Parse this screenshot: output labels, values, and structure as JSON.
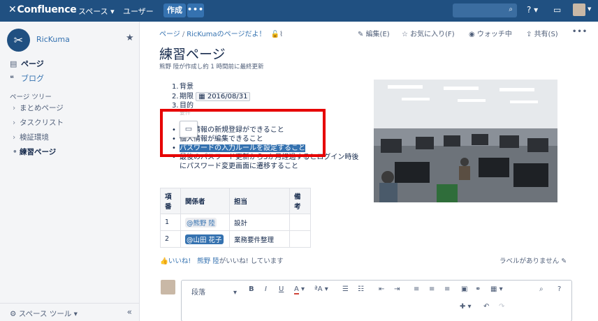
{
  "topbar": {
    "logo": "Confluence",
    "nav": [
      "スペース ▾",
      "ユーザー"
    ],
    "create": "作成",
    "more": "•••",
    "help": "? ▾",
    "inbox": "▭"
  },
  "sidebar": {
    "space_name": "RicKuma",
    "nav": [
      {
        "label": "ページ",
        "icon": "pages-icon"
      },
      {
        "label": "ブログ",
        "icon": "blog-icon"
      }
    ],
    "tree_heading": "ページ ツリー",
    "tree": [
      "まとめページ",
      "タスクリスト",
      "検証環境",
      "練習ページ"
    ],
    "footer_tools": "スペース ツール ▾",
    "collapse": "«"
  },
  "page": {
    "breadcrumbs": [
      "ページ",
      "RicKumaのページだよ！"
    ],
    "actions": [
      "編集(E)",
      "お気に入り(F)",
      "ウォッチ中",
      "共有(S)"
    ],
    "title": "練習ページ",
    "byline": "熊野 陸が作成し約 1 時間前に最終更新",
    "ordered_list": [
      {
        "n": "1.",
        "text": "背景"
      },
      {
        "n": "2.",
        "text": "期限"
      },
      {
        "n": "3.",
        "text": "目的"
      }
    ],
    "deadline_date": "2016/08/31",
    "hidden_item": "要件",
    "bullets": [
      "個人情報の新規登録ができること",
      "個人情報が編集できること",
      "パスワードの入力ルールを設定すること",
      "最後のパスワード更新から3か月経過するとログイン時後",
      "にパスワード変更画面に遷移すること"
    ],
    "table": {
      "headers": [
        "項番",
        "関係者",
        "担当",
        "備考"
      ],
      "rows": [
        {
          "no": "1",
          "person": "@熊野 陸",
          "role": "設計",
          "note": ""
        },
        {
          "no": "2",
          "person": "@山田 花子",
          "role": "業務要件整理",
          "note": ""
        }
      ]
    },
    "likes_link": "いいね!",
    "likes_text": "熊野 陸",
    "likes_suffix": "がいいね! しています",
    "labels": "ラベルがありません",
    "editor": {
      "paragraph": "段落",
      "bold": "B",
      "italic": "I",
      "underline": "U",
      "color": "A",
      "format": "ªA",
      "search": "🔍",
      "help": "?"
    }
  }
}
